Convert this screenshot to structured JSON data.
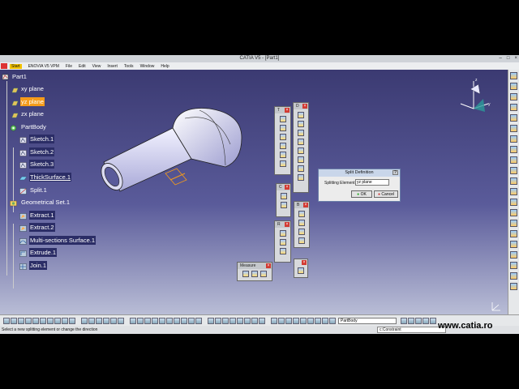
{
  "window": {
    "title": "CATIA V5 - [Part1]",
    "controls": [
      "–",
      "□",
      "×"
    ]
  },
  "menu": [
    "Start",
    "ENOVIA V5 VPM",
    "File",
    "Edit",
    "View",
    "Insert",
    "Tools",
    "Window",
    "Help"
  ],
  "tree": {
    "root": "Part1",
    "items": [
      "xy plane",
      "yz plane",
      "zx plane",
      "PartBody",
      "Sketch.1",
      "Sketch.2",
      "Sketch.3",
      "ThickSurface.1",
      "Split.1",
      "Geometrical Set.1",
      "Extract.1",
      "Extract.2",
      "Multi-sections Surface.1",
      "Extrude.1",
      "Join.1"
    ]
  },
  "toolbars": {
    "panel_a": "T",
    "panel_b": "D",
    "panel_c": "C",
    "panel_d": "R",
    "panel_e": "B",
    "measure": "Measure"
  },
  "split_dialog": {
    "title": "Split Definition",
    "element_label": "Splitting Element:",
    "element_value": "yz plane",
    "ok_label": "OK",
    "cancel_label": "Cancel"
  },
  "workbench_combo": "PartBody",
  "status": {
    "message": "Select a new splitting element or change the direction",
    "command": "c:Constraint"
  },
  "watermark": "www.catia.ro",
  "colors": {
    "viewport_top": "#3b3a72",
    "viewport_bottom": "#b9bdd6",
    "highlight": "#f59b1a"
  }
}
